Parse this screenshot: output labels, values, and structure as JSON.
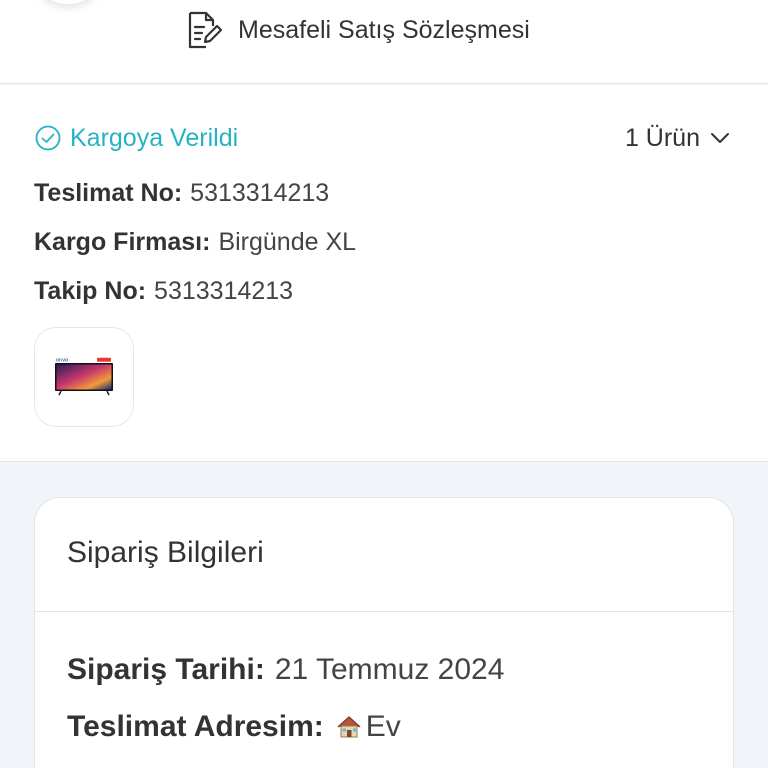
{
  "header": {
    "contract_link_label": "Mesafeli Satış Sözleşmesi"
  },
  "shipment": {
    "status": "Kargoya Verildi",
    "status_color": "#25b3c2",
    "product_count": "1 Ürün",
    "delivery_no_label": "Teslimat No:",
    "delivery_no": "5313314213",
    "carrier_label": "Kargo Firması:",
    "carrier": "Birgünde XL",
    "tracking_label": "Takip No:",
    "tracking_no": "5313314213",
    "product_thumbnail": {
      "brand_text": "onvo",
      "icon": "tv-product-image"
    }
  },
  "order_info": {
    "title": "Sipariş Bilgileri",
    "order_date_label": "Sipariş Tarihi:",
    "order_date": "21 Temmuz 2024",
    "address_label": "Teslimat Adresim:",
    "address_icon": "house-icon",
    "address_name": "Ev"
  }
}
